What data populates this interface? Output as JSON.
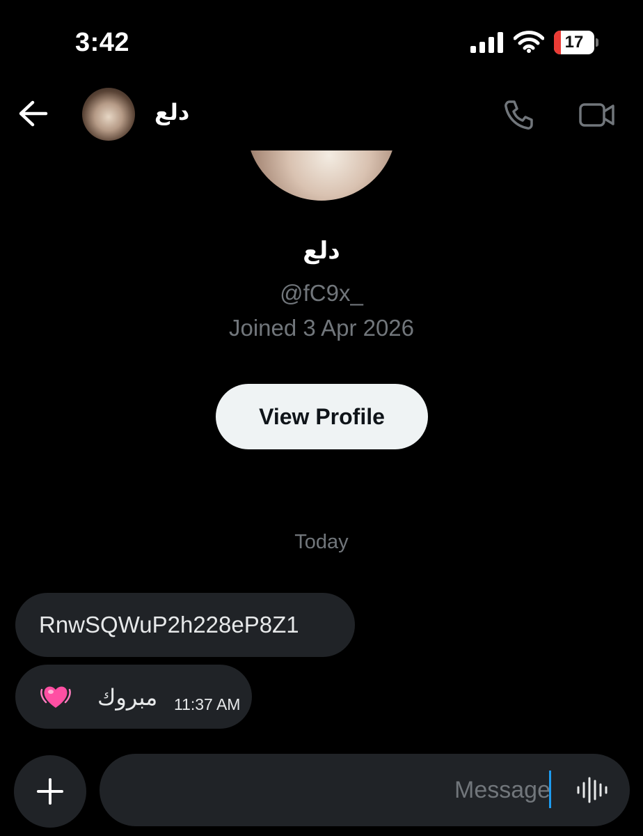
{
  "status_bar": {
    "time": "3:42",
    "battery_level": "17",
    "battery_fraction": 0.17,
    "battery_color": "#eb3b35",
    "signal_icon": "cellular-signal-icon",
    "wifi_icon": "wifi-icon"
  },
  "header": {
    "back_icon": "arrow-left-icon",
    "name": "دلع",
    "call_icon": "phone-icon",
    "video_icon": "video-camera-icon"
  },
  "profile": {
    "name": "دلع",
    "handle": "@fC9x_",
    "joined": "Joined 3 Apr 2026",
    "view_profile_label": "View Profile"
  },
  "conversation": {
    "date_separator": "Today",
    "messages": [
      {
        "text": "RnwSQWuP2h228eP8Z1"
      },
      {
        "text": "مبروك",
        "emoji": "💓",
        "time": "11:37 AM"
      }
    ]
  },
  "composer": {
    "add_icon": "plus-icon",
    "placeholder": "Message",
    "voice_icon": "audio-waveform-icon"
  },
  "colors": {
    "background": "#000000",
    "bubble": "#202327",
    "muted_text": "#71767b",
    "button_bg": "#eff3f4",
    "cursor": "#1d9bf0"
  }
}
